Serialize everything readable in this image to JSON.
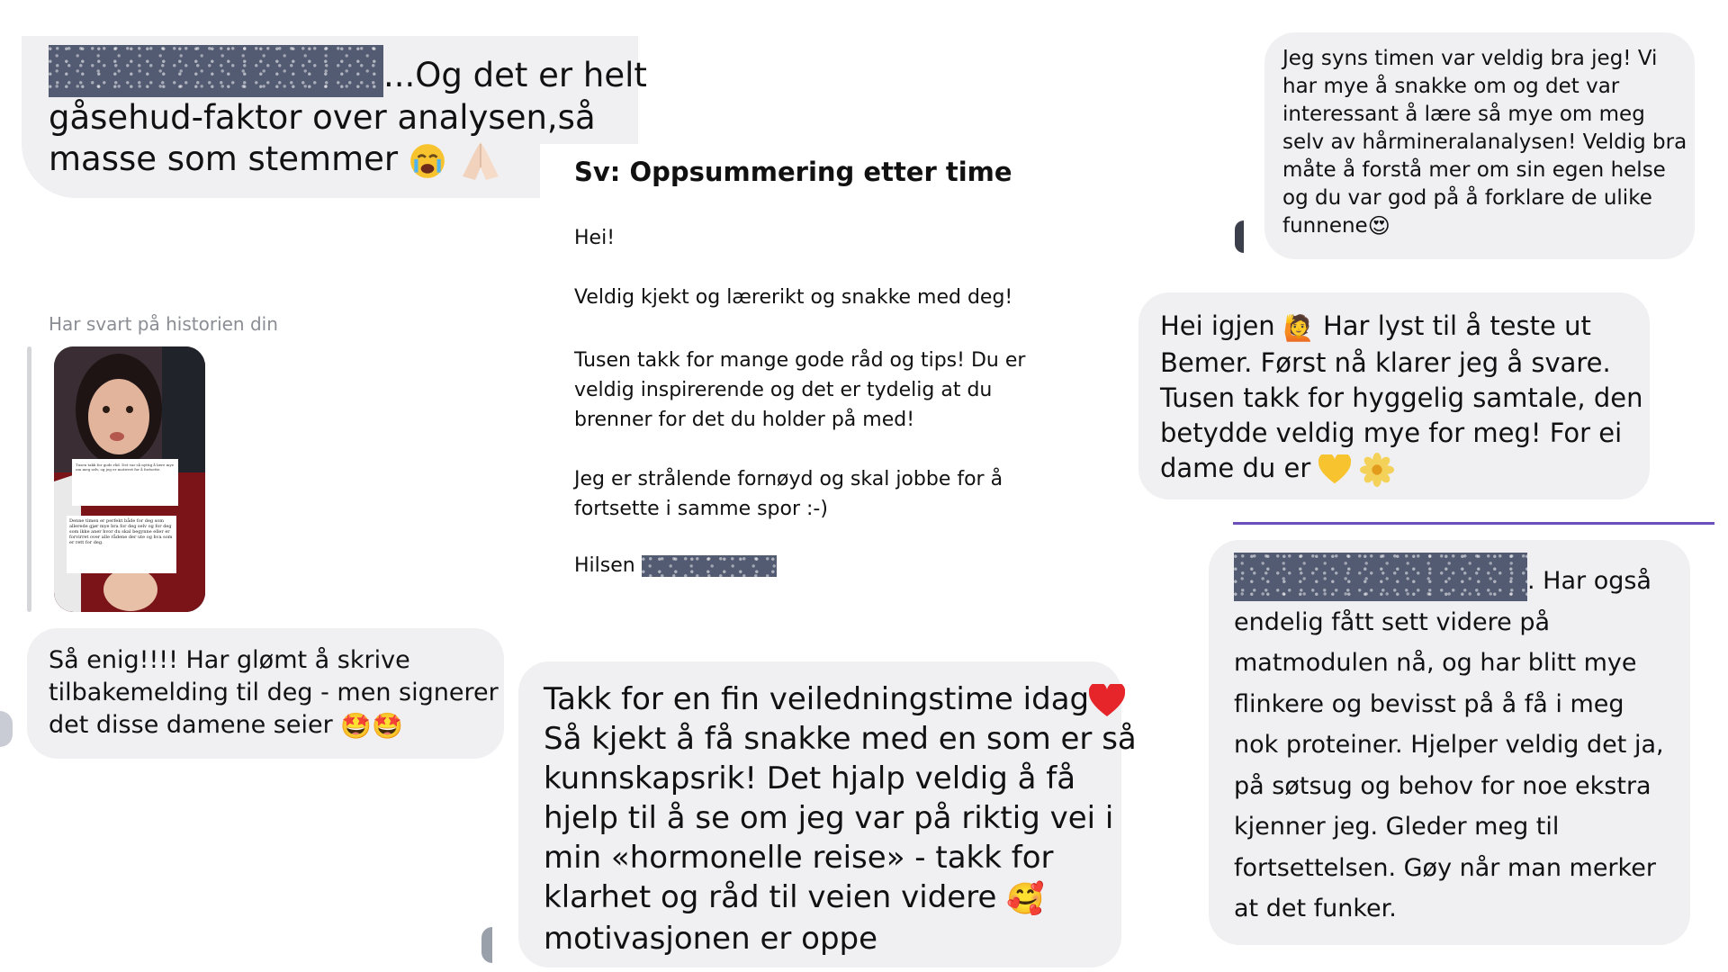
{
  "msg1": {
    "text_line1": "...Og det er helt",
    "text_line2": "gåsehud-faktor over analysen,så",
    "text_line3": "masse som stemmer"
  },
  "story_reply": {
    "caption": "Har svart på historien din",
    "thumb_text_top": "Tusen takk for gode råd. Det var så nyttig å lære mye om meg selv, og jeg er motivert for å fortsette.",
    "thumb_text_bottom": "Denne timen er perfekt både for deg som allerede gjør mye bra for deg selv og for deg som ikke aner hvor du skal begynne eller er forvirret over alle rådene der ute og hva som er rett for deg.",
    "reply_line1": "Så enig!!!! Har glømt å skrive",
    "reply_line2": "tilbakemelding til deg - men signerer",
    "reply_line3": "det disse damene seier"
  },
  "email": {
    "subject": "Sv: Oppsummering etter time",
    "greeting": "Hei!",
    "p1": "Veldig kjekt og lærerikt og snakke med deg!",
    "p2_line1": "Tusen takk for mange gode råd og tips! Du er",
    "p2_line2": "veldig inspirerende og det er tydelig at du",
    "p2_line3": "brenner for det du holder på med!",
    "p3_line1": "Jeg er strålende fornøyd og skal jobbe for å",
    "p3_line2": "fortsette i samme spor :-)",
    "signoff": "Hilsen"
  },
  "msg_center": {
    "line1": "Takk for en fin veiledningstime idag",
    "line2": "Så kjekt å få snakke med en som er så",
    "line3": "kunnskapsrik! Det hjalp veldig å få",
    "line4": "hjelp til å se om jeg var på riktig vei i",
    "line5": "min «hormonelle reise» - takk for",
    "line6": "klarhet og råd til veien videre",
    "line7": "motivasjonen er oppe"
  },
  "msg_right1": {
    "line1": "Jeg syns timen var veldig bra jeg! Vi",
    "line2": "har mye å snakke om og det var",
    "line3": "interessant å lære så mye om meg",
    "line4": "selv av hårmineralanalysen! Veldig bra",
    "line5": "måte å forstå mer om sin egen helse",
    "line6": "og du var god på å forklare de ulike",
    "line7": "funnene"
  },
  "msg_right2": {
    "line1a": "Hei igjen",
    "line1b": "Har lyst til å teste ut",
    "line2": "Bemer. Først nå klarer jeg å svare.",
    "line3": "Tusen takk for hyggelig samtale, den",
    "line4": "betydde veldig mye for meg! For ei",
    "line5": "dame du er"
  },
  "msg_right3": {
    "line1": ". Har også",
    "line2": "endelig fått sett videre på",
    "line3": "matmodulen nå, og har blitt mye",
    "line4": "flinkere og bevisst på å få i meg",
    "line5": "nok proteiner. Hjelper veldig det ja,",
    "line6": "på søtsug og behov for noe ekstra",
    "line7": "kjenner jeg. Gleder meg til",
    "line8": "fortsettelsen. Gøy når man merker",
    "line9": "at det funker."
  },
  "colors": {
    "bubble": "#f0f0f2",
    "redaction": "#535b72",
    "accent_line": "#6b4fbb",
    "caption": "#8a8d93"
  }
}
